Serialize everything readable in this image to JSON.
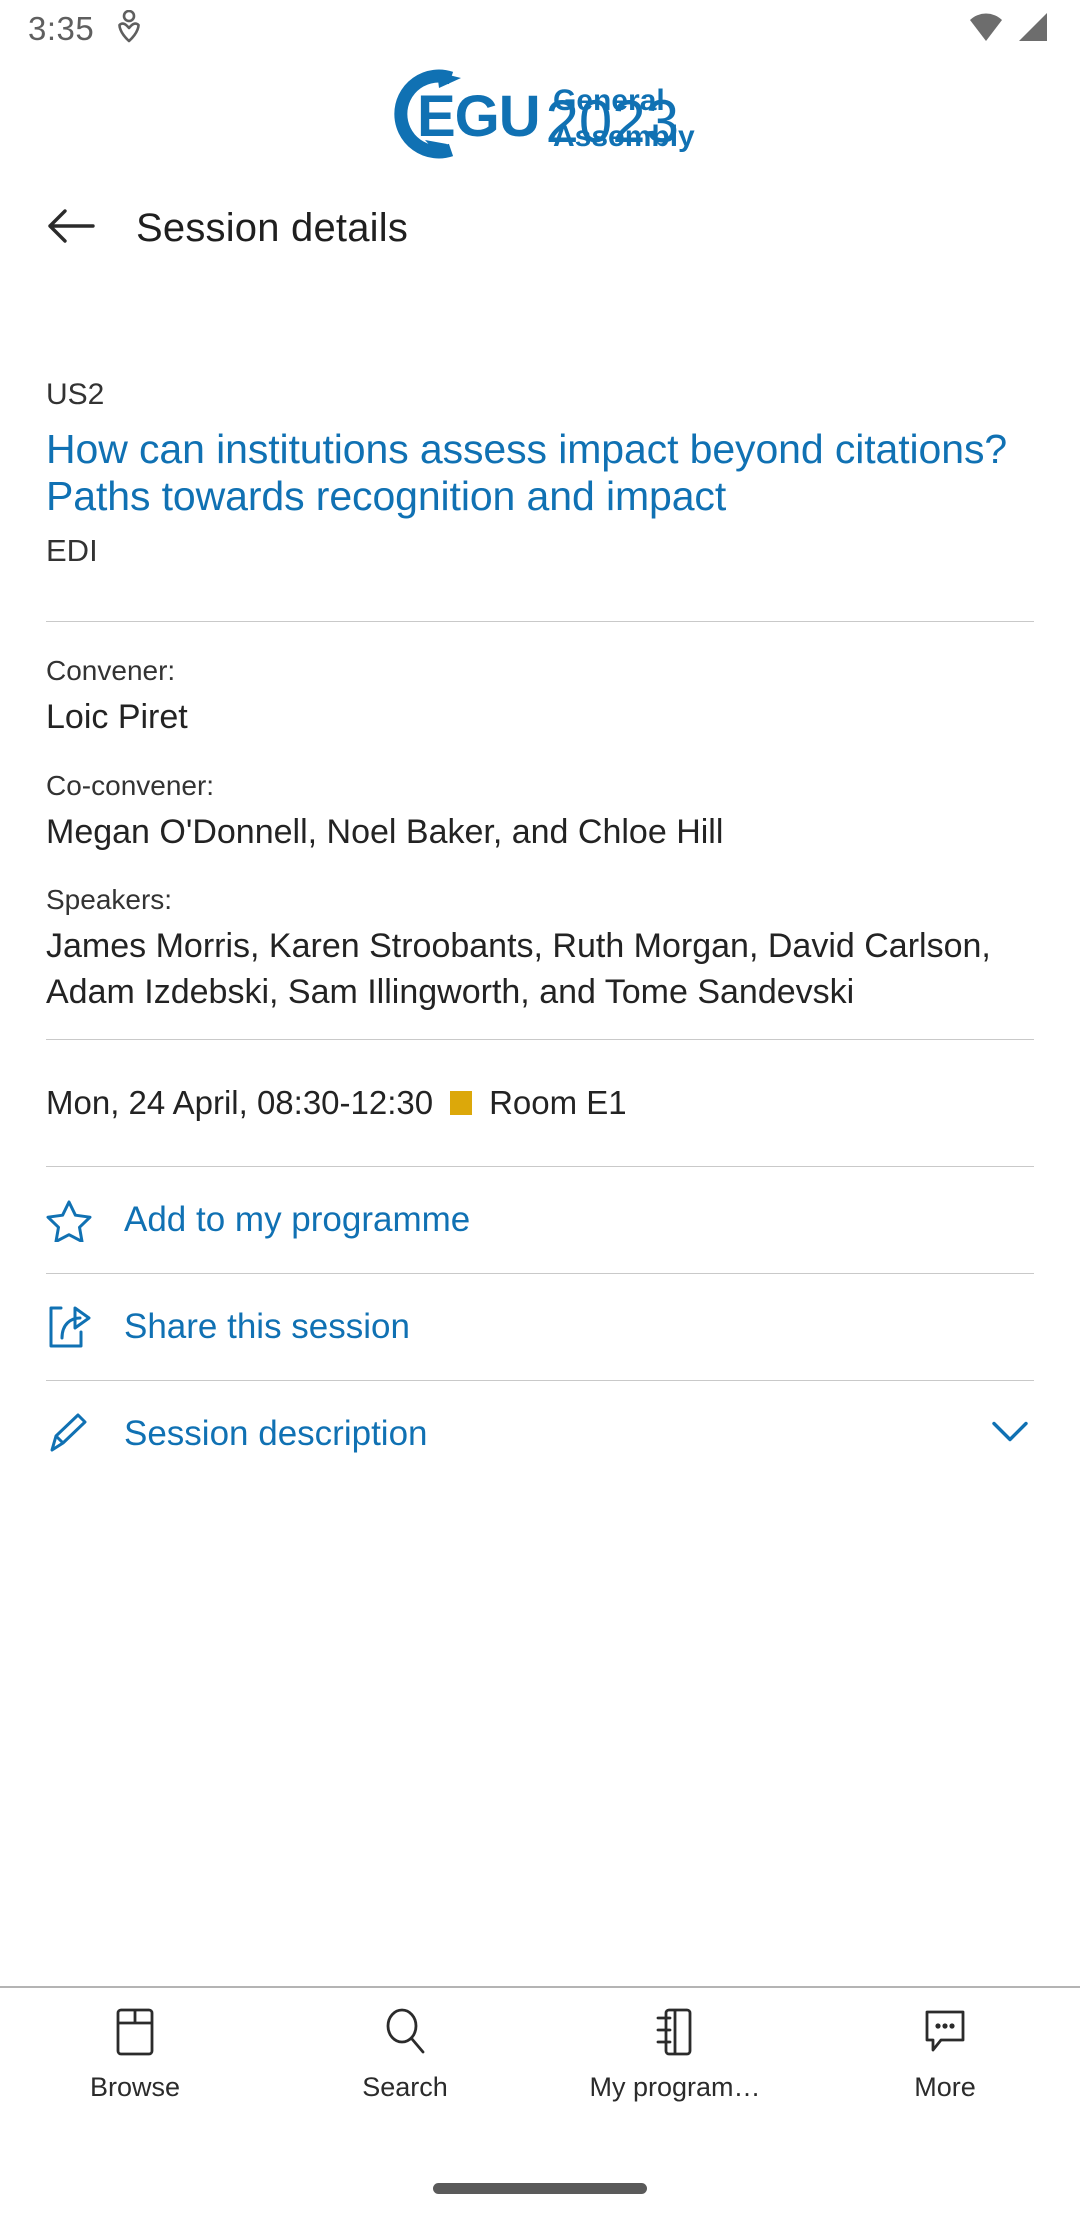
{
  "status_bar": {
    "time": "3:35",
    "icons": [
      "location-sharing-icon",
      "wifi-icon",
      "cellular-signal-icon"
    ]
  },
  "brand": {
    "logo_text_egu": "EGU",
    "logo_text_general": "General",
    "logo_text_assembly": "Assembly",
    "logo_text_year": "2023",
    "logo_color": "#1071b3"
  },
  "app_bar": {
    "back_icon": "arrow-left-icon",
    "title": "Session details"
  },
  "session": {
    "code": "US2",
    "title": "How can institutions assess impact beyond citations? Paths towards recognition and impact",
    "tag": "EDI",
    "convener_label": "Convener:",
    "convener_value": "Loic Piret",
    "coconvener_label": "Co-convener:",
    "coconvener_value": "Megan O'Donnell, Noel Baker, and Chloe Hill",
    "speakers_label": "Speakers:",
    "speakers_value": "James Morris, Karen Stroobants, Ruth Morgan, David Carlson, Adam Izdebski, Sam Illingworth, and Tome Sandevski",
    "when": "Mon, 24 April, 08:30-12:30",
    "room": "Room E1",
    "room_color": "#dca80a"
  },
  "actions": [
    {
      "id": "add-to-programme",
      "icon": "star-outline-icon",
      "label": "Add to my programme"
    },
    {
      "id": "share-session",
      "icon": "share-icon",
      "label": "Share this session"
    },
    {
      "id": "session-description",
      "icon": "pencil-icon",
      "label": "Session description",
      "chevron": "chevron-down-icon"
    }
  ],
  "bottom_nav": {
    "items": [
      {
        "id": "browse",
        "icon": "browse-icon",
        "label": "Browse"
      },
      {
        "id": "search",
        "icon": "search-icon",
        "label": "Search"
      },
      {
        "id": "my-programme",
        "icon": "notebook-icon",
        "label": "My program…"
      },
      {
        "id": "more",
        "icon": "chat-dots-icon",
        "label": "More"
      }
    ]
  },
  "theme": {
    "link_blue": "#1071b3",
    "text_dark": "#232323",
    "divider": "#c9c9c9"
  }
}
